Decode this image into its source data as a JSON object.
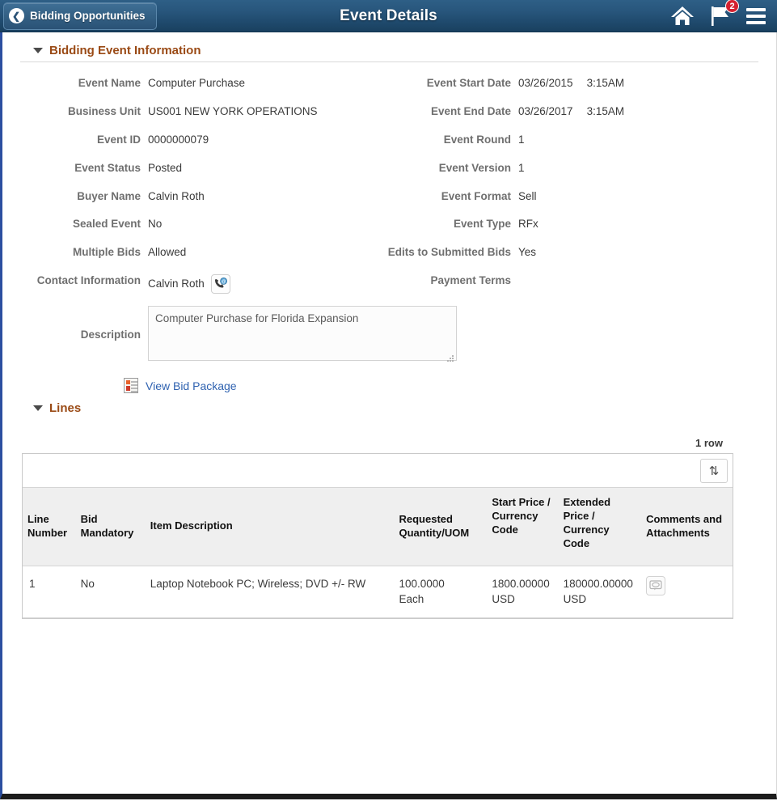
{
  "header": {
    "back_label": "Bidding Opportunities",
    "title": "Event Details",
    "notification_count": "2"
  },
  "event_section": {
    "title": "Bidding Event Information",
    "left_fields": [
      {
        "label": "Event Name",
        "value": "Computer Purchase"
      },
      {
        "label": "Business Unit",
        "value": "US001 NEW YORK OPERATIONS"
      },
      {
        "label": "Event ID",
        "value": "0000000079"
      },
      {
        "label": "Event Status",
        "value": "Posted"
      },
      {
        "label": "Buyer Name",
        "value": "Calvin Roth"
      },
      {
        "label": "Sealed Event",
        "value": "No"
      },
      {
        "label": "Multiple Bids",
        "value": "Allowed"
      },
      {
        "label": "Contact Information",
        "value": "Calvin Roth"
      }
    ],
    "right_fields": [
      {
        "label": "Event Start Date",
        "value": "03/26/2015",
        "time": "3:15AM"
      },
      {
        "label": "Event End Date",
        "value": "03/26/2017",
        "time": "3:15AM"
      },
      {
        "label": "Event Round",
        "value": "1",
        "time": ""
      },
      {
        "label": "Event Version",
        "value": "1",
        "time": ""
      },
      {
        "label": "Event Format",
        "value": "Sell",
        "time": ""
      },
      {
        "label": "Event Type",
        "value": "RFx",
        "time": ""
      },
      {
        "label": "Edits to Submitted Bids",
        "value": "Yes",
        "time": ""
      },
      {
        "label": "Payment Terms",
        "value": "",
        "time": ""
      }
    ],
    "description_label": "Description",
    "description_value": "Computer Purchase for Florida Expansion",
    "bid_package_label": "View Bid Package"
  },
  "lines_section": {
    "title": "Lines",
    "row_count": "1 row",
    "columns": [
      "Line Number",
      "Bid Mandatory",
      "Item Description",
      "Requested Quantity/UOM",
      "Start Price / Currency Code",
      "Extended Price / Currency Code",
      "Comments and Attachments"
    ],
    "rows": [
      {
        "line_number": "1",
        "bid_mandatory": "No",
        "item_description": "Laptop Notebook PC; Wireless; DVD +/- RW",
        "quantity": "100.0000",
        "uom": "Each",
        "start_price": "1800.00000",
        "start_currency": "USD",
        "extended_price": "180000.00000",
        "extended_currency": "USD"
      }
    ]
  },
  "icons": {
    "home": "home-icon",
    "flag": "flag-icon",
    "menu": "hamburger-menu-icon",
    "back": "chevron-left-icon",
    "contact": "contact-phone-email-icon",
    "bid_package": "document-list-icon",
    "sort": "sort-arrows-icon",
    "comment": "comment-bubble-icon"
  },
  "colors": {
    "header_blue": "#28567c",
    "section_title": "#9a4a15",
    "link_blue": "#2f62b0",
    "badge_red": "#d5202f",
    "left_border": "#2c4fa0"
  }
}
